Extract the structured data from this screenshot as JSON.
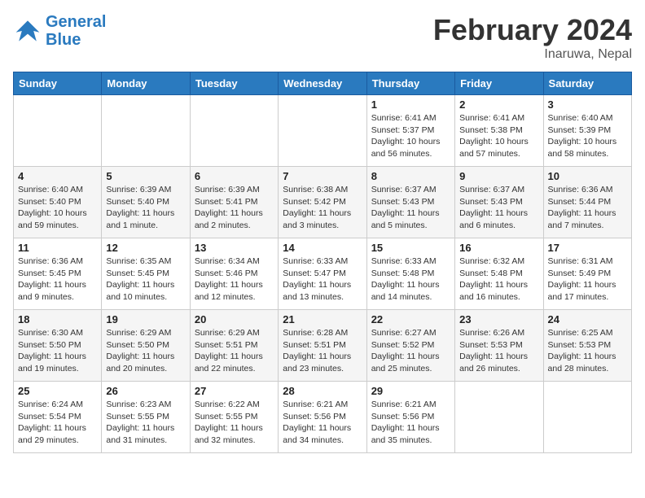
{
  "header": {
    "logo_line1": "General",
    "logo_line2": "Blue",
    "month": "February 2024",
    "location": "Inaruwa, Nepal"
  },
  "weekdays": [
    "Sunday",
    "Monday",
    "Tuesday",
    "Wednesday",
    "Thursday",
    "Friday",
    "Saturday"
  ],
  "weeks": [
    [
      {
        "day": "",
        "info": ""
      },
      {
        "day": "",
        "info": ""
      },
      {
        "day": "",
        "info": ""
      },
      {
        "day": "",
        "info": ""
      },
      {
        "day": "1",
        "info": "Sunrise: 6:41 AM\nSunset: 5:37 PM\nDaylight: 10 hours\nand 56 minutes."
      },
      {
        "day": "2",
        "info": "Sunrise: 6:41 AM\nSunset: 5:38 PM\nDaylight: 10 hours\nand 57 minutes."
      },
      {
        "day": "3",
        "info": "Sunrise: 6:40 AM\nSunset: 5:39 PM\nDaylight: 10 hours\nand 58 minutes."
      }
    ],
    [
      {
        "day": "4",
        "info": "Sunrise: 6:40 AM\nSunset: 5:40 PM\nDaylight: 10 hours\nand 59 minutes."
      },
      {
        "day": "5",
        "info": "Sunrise: 6:39 AM\nSunset: 5:40 PM\nDaylight: 11 hours\nand 1 minute."
      },
      {
        "day": "6",
        "info": "Sunrise: 6:39 AM\nSunset: 5:41 PM\nDaylight: 11 hours\nand 2 minutes."
      },
      {
        "day": "7",
        "info": "Sunrise: 6:38 AM\nSunset: 5:42 PM\nDaylight: 11 hours\nand 3 minutes."
      },
      {
        "day": "8",
        "info": "Sunrise: 6:37 AM\nSunset: 5:43 PM\nDaylight: 11 hours\nand 5 minutes."
      },
      {
        "day": "9",
        "info": "Sunrise: 6:37 AM\nSunset: 5:43 PM\nDaylight: 11 hours\nand 6 minutes."
      },
      {
        "day": "10",
        "info": "Sunrise: 6:36 AM\nSunset: 5:44 PM\nDaylight: 11 hours\nand 7 minutes."
      }
    ],
    [
      {
        "day": "11",
        "info": "Sunrise: 6:36 AM\nSunset: 5:45 PM\nDaylight: 11 hours\nand 9 minutes."
      },
      {
        "day": "12",
        "info": "Sunrise: 6:35 AM\nSunset: 5:45 PM\nDaylight: 11 hours\nand 10 minutes."
      },
      {
        "day": "13",
        "info": "Sunrise: 6:34 AM\nSunset: 5:46 PM\nDaylight: 11 hours\nand 12 minutes."
      },
      {
        "day": "14",
        "info": "Sunrise: 6:33 AM\nSunset: 5:47 PM\nDaylight: 11 hours\nand 13 minutes."
      },
      {
        "day": "15",
        "info": "Sunrise: 6:33 AM\nSunset: 5:48 PM\nDaylight: 11 hours\nand 14 minutes."
      },
      {
        "day": "16",
        "info": "Sunrise: 6:32 AM\nSunset: 5:48 PM\nDaylight: 11 hours\nand 16 minutes."
      },
      {
        "day": "17",
        "info": "Sunrise: 6:31 AM\nSunset: 5:49 PM\nDaylight: 11 hours\nand 17 minutes."
      }
    ],
    [
      {
        "day": "18",
        "info": "Sunrise: 6:30 AM\nSunset: 5:50 PM\nDaylight: 11 hours\nand 19 minutes."
      },
      {
        "day": "19",
        "info": "Sunrise: 6:29 AM\nSunset: 5:50 PM\nDaylight: 11 hours\nand 20 minutes."
      },
      {
        "day": "20",
        "info": "Sunrise: 6:29 AM\nSunset: 5:51 PM\nDaylight: 11 hours\nand 22 minutes."
      },
      {
        "day": "21",
        "info": "Sunrise: 6:28 AM\nSunset: 5:51 PM\nDaylight: 11 hours\nand 23 minutes."
      },
      {
        "day": "22",
        "info": "Sunrise: 6:27 AM\nSunset: 5:52 PM\nDaylight: 11 hours\nand 25 minutes."
      },
      {
        "day": "23",
        "info": "Sunrise: 6:26 AM\nSunset: 5:53 PM\nDaylight: 11 hours\nand 26 minutes."
      },
      {
        "day": "24",
        "info": "Sunrise: 6:25 AM\nSunset: 5:53 PM\nDaylight: 11 hours\nand 28 minutes."
      }
    ],
    [
      {
        "day": "25",
        "info": "Sunrise: 6:24 AM\nSunset: 5:54 PM\nDaylight: 11 hours\nand 29 minutes."
      },
      {
        "day": "26",
        "info": "Sunrise: 6:23 AM\nSunset: 5:55 PM\nDaylight: 11 hours\nand 31 minutes."
      },
      {
        "day": "27",
        "info": "Sunrise: 6:22 AM\nSunset: 5:55 PM\nDaylight: 11 hours\nand 32 minutes."
      },
      {
        "day": "28",
        "info": "Sunrise: 6:21 AM\nSunset: 5:56 PM\nDaylight: 11 hours\nand 34 minutes."
      },
      {
        "day": "29",
        "info": "Sunrise: 6:21 AM\nSunset: 5:56 PM\nDaylight: 11 hours\nand 35 minutes."
      },
      {
        "day": "",
        "info": ""
      },
      {
        "day": "",
        "info": ""
      }
    ]
  ]
}
